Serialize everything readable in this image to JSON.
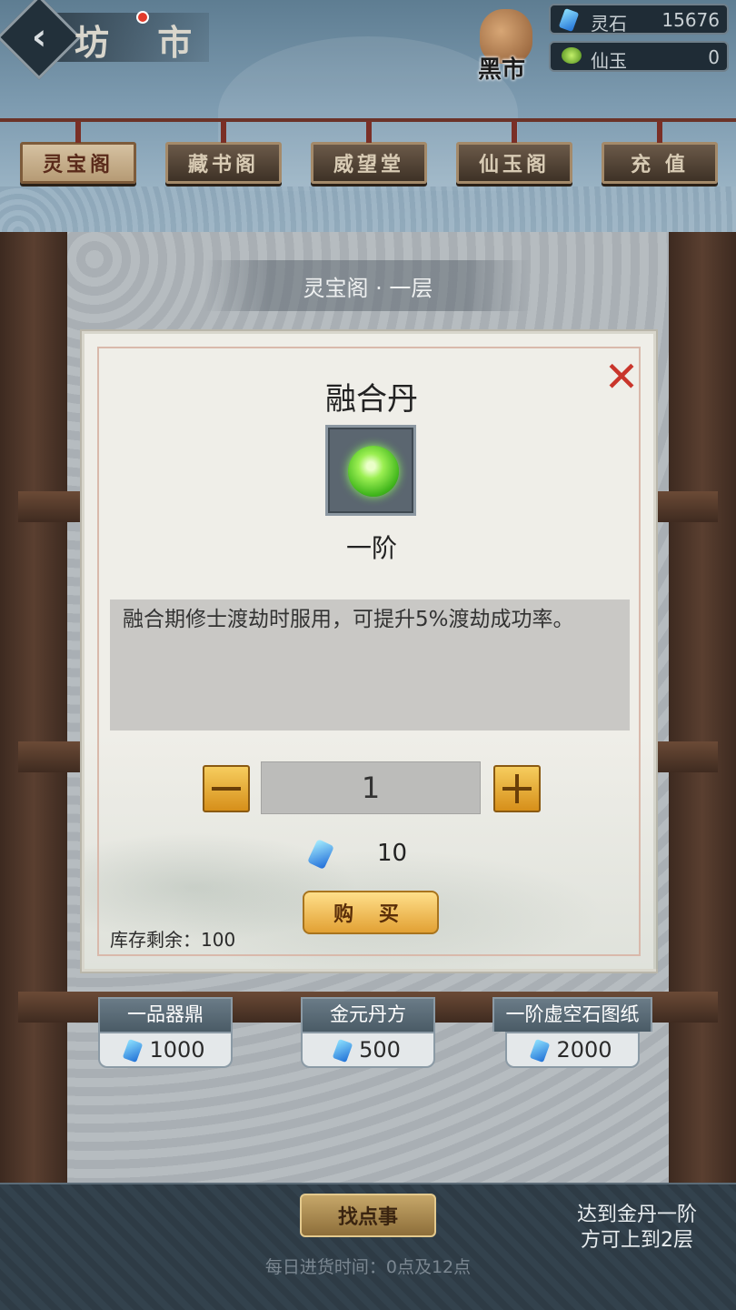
{
  "header": {
    "title": "坊 市",
    "back_glyph": "‹",
    "black_market_label": "黑市"
  },
  "currencies": [
    {
      "name": "灵石",
      "value": "15676",
      "icon": "spirit-stone-icon",
      "color": "#3aa0ff"
    },
    {
      "name": "仙玉",
      "value": "0",
      "icon": "jade-icon",
      "color": "#7fd13a"
    }
  ],
  "tabs": [
    {
      "label": "灵宝阁",
      "active": true
    },
    {
      "label": "藏书阁",
      "active": false
    },
    {
      "label": "威望堂",
      "active": false
    },
    {
      "label": "仙玉阁",
      "active": false
    },
    {
      "label": "充 值",
      "active": false
    }
  ],
  "shop": {
    "floor_title": "灵宝阁 · 一层",
    "products": [
      {
        "name": "一品器鼎",
        "price": "1000"
      },
      {
        "name": "金元丹方",
        "price": "500"
      },
      {
        "name": "一阶虚空石图纸",
        "price": "2000"
      }
    ]
  },
  "modal": {
    "close_glyph": "✕",
    "item_name": "融合丹",
    "grade": "一阶",
    "description": "融合期修士渡劫时服用，可提升5%渡劫成功率。",
    "quantity": "1",
    "price": "10",
    "buy_label": "购 买",
    "stock_label": "库存剩余：100"
  },
  "footer": {
    "errand_label": "找点事",
    "restock_text": "每日进货时间：0点及12点",
    "unlock_hint_line1": "达到金丹一阶",
    "unlock_hint_line2": "方可上到2层"
  },
  "colors": {
    "accent_gold": "#e2a134",
    "close_red": "#c9352b",
    "tab_active": "#d5c1a1"
  }
}
